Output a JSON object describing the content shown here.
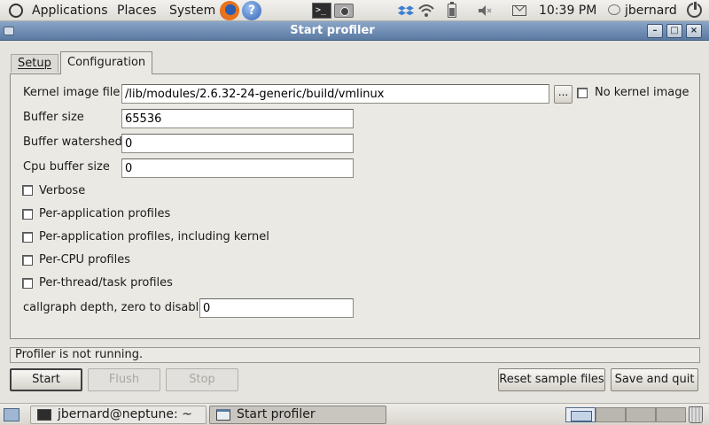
{
  "top_panel": {
    "menus": [
      "Applications",
      "Places",
      "System"
    ],
    "clock": "10:39 PM",
    "user": "jbernard"
  },
  "window": {
    "title": "Start profiler",
    "controls": [
      "menu-icon",
      "minimize-icon",
      "maximize-icon",
      "close-icon"
    ]
  },
  "tabs": [
    {
      "label": "Setup",
      "active": false
    },
    {
      "label": "Configuration",
      "active": true
    }
  ],
  "form": {
    "kernel_image": {
      "label": "Kernel image file",
      "value": "/lib/modules/2.6.32-24-generic/build/vmlinux"
    },
    "browse_label": "...",
    "no_kernel_image": {
      "label": "No kernel image",
      "checked": false
    },
    "buffer_size": {
      "label": "Buffer size",
      "value": "65536"
    },
    "buffer_watershed": {
      "label": "Buffer watershed",
      "value": "0"
    },
    "cpu_buffer_size": {
      "label": "Cpu buffer size",
      "value": "0"
    },
    "checkboxes": [
      {
        "label": "Verbose",
        "checked": false
      },
      {
        "label": "Per-application profiles",
        "checked": false
      },
      {
        "label": "Per-application profiles, including kernel",
        "checked": false
      },
      {
        "label": "Per-CPU profiles",
        "checked": false
      },
      {
        "label": "Per-thread/task profiles",
        "checked": false
      }
    ],
    "callgraph_depth": {
      "label": "callgraph depth, zero to disable",
      "value": "0"
    }
  },
  "status": "Profiler is not running.",
  "buttons": {
    "start": {
      "label": "Start",
      "enabled": true
    },
    "flush": {
      "label": "Flush",
      "enabled": false
    },
    "stop": {
      "label": "Stop",
      "enabled": false
    },
    "reset": {
      "label": "Reset sample files",
      "enabled": true
    },
    "save_quit": {
      "label": "Save and quit",
      "enabled": true
    }
  },
  "bottom_panel": {
    "tasks": [
      {
        "label": "jbernard@neptune: ~",
        "icon": "terminal-icon",
        "active": false
      },
      {
        "label": "Start profiler",
        "icon": "window-icon",
        "active": true
      }
    ],
    "workspaces": 4,
    "active_workspace": 1
  },
  "colors": {
    "titlebar": "#5b7aa2",
    "window_bg": "#ebe9e4",
    "panel_bg": "#e6e4df"
  },
  "icons": [
    "ubuntu-logo-icon",
    "firefox-icon",
    "help-icon",
    "terminal-icon",
    "screenshot-icon",
    "dropbox-icon",
    "wifi-icon",
    "battery-icon",
    "volume-icon",
    "mail-icon",
    "chat-icon",
    "power-icon",
    "show-desktop-icon",
    "trash-icon"
  ]
}
